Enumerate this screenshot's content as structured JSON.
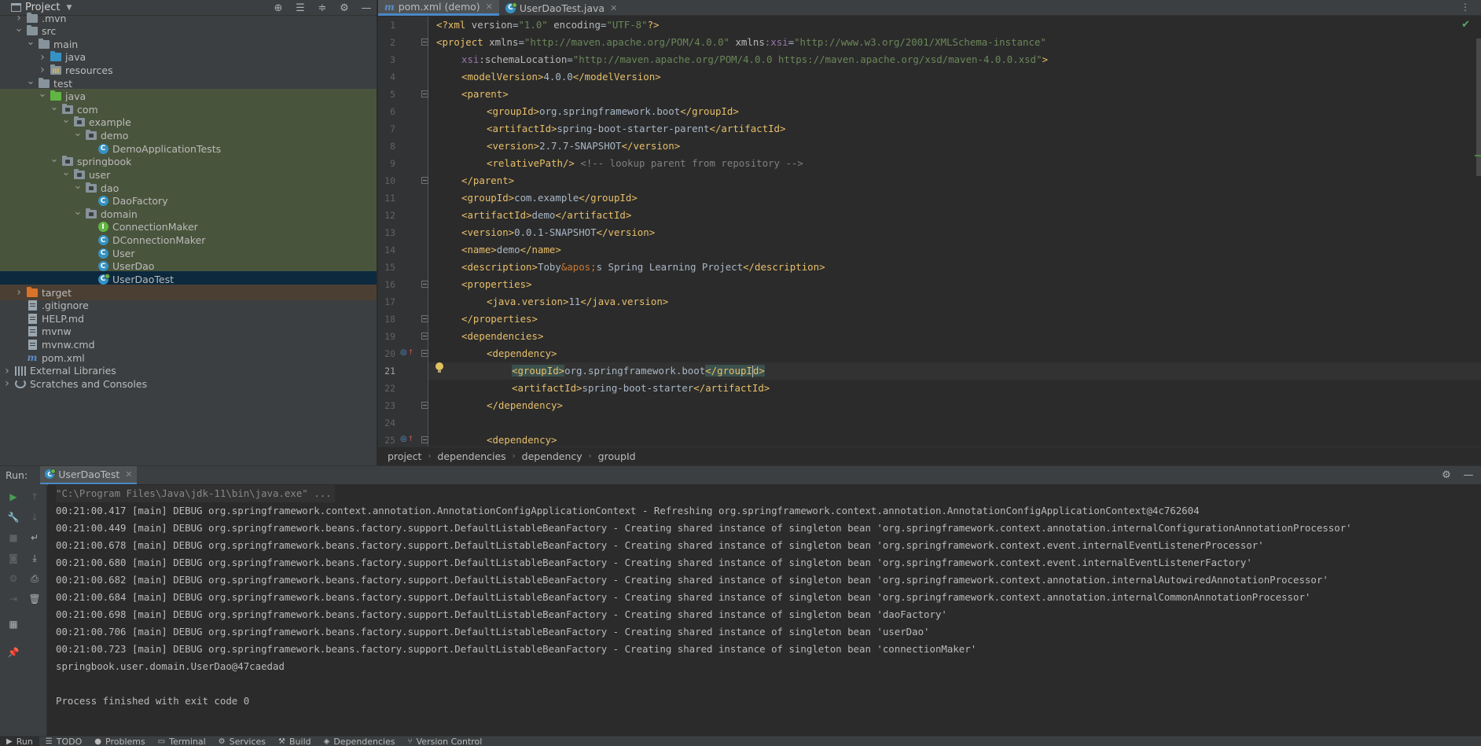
{
  "project_pane": {
    "title": "Project",
    "header_icons": [
      "locate-icon",
      "expand-all-icon",
      "collapse-all-icon",
      "gear-icon",
      "hide-icon"
    ],
    "tree": [
      {
        "label": ".mvn",
        "depth": 2,
        "expanded": false,
        "icon": "folder"
      },
      {
        "label": "src",
        "depth": 2,
        "expanded": true,
        "icon": "folder"
      },
      {
        "label": "main",
        "depth": 3,
        "expanded": true,
        "icon": "folder"
      },
      {
        "label": "java",
        "depth": 4,
        "expanded": false,
        "icon": "source-folder"
      },
      {
        "label": "resources",
        "depth": 4,
        "expanded": false,
        "icon": "resources-folder"
      },
      {
        "label": "test",
        "depth": 3,
        "expanded": true,
        "icon": "folder"
      },
      {
        "label": "java",
        "depth": 4,
        "expanded": true,
        "icon": "test-source-folder"
      },
      {
        "label": "com",
        "depth": 5,
        "expanded": true,
        "icon": "package"
      },
      {
        "label": "example",
        "depth": 6,
        "expanded": true,
        "icon": "package"
      },
      {
        "label": "demo",
        "depth": 7,
        "expanded": true,
        "icon": "package"
      },
      {
        "label": "DemoApplicationTests",
        "depth": 8,
        "icon": "class"
      },
      {
        "label": "springbook",
        "depth": 5,
        "expanded": true,
        "icon": "package"
      },
      {
        "label": "user",
        "depth": 6,
        "expanded": true,
        "icon": "package"
      },
      {
        "label": "dao",
        "depth": 7,
        "expanded": true,
        "icon": "package"
      },
      {
        "label": "DaoFactory",
        "depth": 8,
        "icon": "class"
      },
      {
        "label": "domain",
        "depth": 7,
        "expanded": true,
        "icon": "package"
      },
      {
        "label": "ConnectionMaker",
        "depth": 8,
        "icon": "interface"
      },
      {
        "label": "DConnectionMaker",
        "depth": 8,
        "icon": "class"
      },
      {
        "label": "User",
        "depth": 8,
        "icon": "class"
      },
      {
        "label": "UserDao",
        "depth": 8,
        "icon": "class"
      },
      {
        "label": "UserDaoTest",
        "depth": 8,
        "icon": "test-class"
      },
      {
        "label": "target",
        "depth": 2,
        "expanded": false,
        "icon": "excluded-folder"
      },
      {
        "label": ".gitignore",
        "depth": 2,
        "icon": "file"
      },
      {
        "label": "HELP.md",
        "depth": 2,
        "icon": "file"
      },
      {
        "label": "mvnw",
        "depth": 2,
        "icon": "file"
      },
      {
        "label": "mvnw.cmd",
        "depth": 2,
        "icon": "file"
      },
      {
        "label": "pom.xml",
        "depth": 2,
        "icon": "maven"
      },
      {
        "label": "External Libraries",
        "depth": 1,
        "expanded": false,
        "icon": "libraries"
      },
      {
        "label": "Scratches and Consoles",
        "depth": 1,
        "expanded": false,
        "icon": "scratches"
      }
    ]
  },
  "editor": {
    "tabs": [
      {
        "label": "pom.xml (demo)",
        "icon": "maven",
        "active": true
      },
      {
        "label": "UserDaoTest.java",
        "icon": "test-class",
        "active": false
      }
    ],
    "current_line": 21,
    "lines": [
      {
        "n": "1"
      },
      {
        "n": "2"
      },
      {
        "n": "3"
      },
      {
        "n": "4"
      },
      {
        "n": "5"
      },
      {
        "n": "6"
      },
      {
        "n": "7"
      },
      {
        "n": "8"
      },
      {
        "n": "9"
      },
      {
        "n": "10"
      },
      {
        "n": "11"
      },
      {
        "n": "12"
      },
      {
        "n": "13"
      },
      {
        "n": "14"
      },
      {
        "n": "15"
      },
      {
        "n": "16"
      },
      {
        "n": "17"
      },
      {
        "n": "18"
      },
      {
        "n": "19"
      },
      {
        "n": "20"
      },
      {
        "n": "21"
      },
      {
        "n": "22"
      },
      {
        "n": "23"
      },
      {
        "n": "24"
      },
      {
        "n": "25"
      }
    ],
    "code": {
      "l1_a": "<?xml ",
      "l1_b": "version",
      "l1_c": "=",
      "l1_d": "\"1.0\"",
      "l1_e": " encoding",
      "l1_f": "=",
      "l1_g": "\"UTF-8\"",
      "l1_h": "?>",
      "l2_a": "<project ",
      "l2_b": "xmlns",
      "l2_c": "=",
      "l2_d": "\"http://maven.apache.org/POM/4.0.0\"",
      "l2_e": " xmlns",
      "l2_f": ":xsi",
      "l2_g": "=",
      "l2_h": "\"http://www.w3.org/2001/XMLSchema-instance\"",
      "l3_a": "xsi",
      "l3_b": ":schemaLocation",
      "l3_c": "=",
      "l3_d": "\"http://maven.apache.org/POM/4.0.0 https://maven.apache.org/xsd/maven-4.0.0.xsd\"",
      "l3_e": ">",
      "l4_a": "<modelVersion>",
      "l4_b": "4.0.0",
      "l4_c": "</modelVersion>",
      "l5_a": "<parent>",
      "l6_a": "<groupId>",
      "l6_b": "org.springframework.boot",
      "l6_c": "</groupId>",
      "l7_a": "<artifactId>",
      "l7_b": "spring-boot-starter-parent",
      "l7_c": "</artifactId>",
      "l8_a": "<version>",
      "l8_b": "2.7.7-SNAPSHOT",
      "l8_c": "</version>",
      "l9_a": "<relativePath/>",
      "l9_b": " <!-- lookup parent from repository -->",
      "l10_a": "</parent>",
      "l11_a": "<groupId>",
      "l11_b": "com.example",
      "l11_c": "</groupId>",
      "l12_a": "<artifactId>",
      "l12_b": "demo",
      "l12_c": "</artifactId>",
      "l13_a": "<version>",
      "l13_b": "0.0.1-SNAPSHOT",
      "l13_c": "</version>",
      "l14_a": "<name>",
      "l14_b": "demo",
      "l14_c": "</name>",
      "l15_a": "<description>",
      "l15_b": "Toby",
      "l15_c": "&apos;",
      "l15_d": "s Spring Learning Project",
      "l15_e": "</description>",
      "l16_a": "<properties>",
      "l17_a": "<java.version>",
      "l17_b": "11",
      "l17_c": "</java.version>",
      "l18_a": "</properties>",
      "l19_a": "<dependencies>",
      "l20_a": "<dependency>",
      "l21_a": "<groupId>",
      "l21_b": "org.springframework.boot",
      "l21_c": "</groupI",
      "l21_d": "d>",
      "l22_a": "<artifactId>",
      "l22_b": "spring-boot-starter",
      "l22_c": "</artifactId>",
      "l23_a": "</dependency>",
      "l25_a": "<dependency>"
    },
    "breadcrumb": [
      "project",
      "dependencies",
      "dependency",
      "groupId"
    ]
  },
  "run": {
    "label": "Run:",
    "tab": "UserDaoTest",
    "console": [
      "\"C:\\Program Files\\Java\\jdk-11\\bin\\java.exe\" ...",
      "00:21:00.417 [main] DEBUG org.springframework.context.annotation.AnnotationConfigApplicationContext - Refreshing org.springframework.context.annotation.AnnotationConfigApplicationContext@4c762604",
      "00:21:00.449 [main] DEBUG org.springframework.beans.factory.support.DefaultListableBeanFactory - Creating shared instance of singleton bean 'org.springframework.context.annotation.internalConfigurationAnnotationProcessor'",
      "00:21:00.678 [main] DEBUG org.springframework.beans.factory.support.DefaultListableBeanFactory - Creating shared instance of singleton bean 'org.springframework.context.event.internalEventListenerProcessor'",
      "00:21:00.680 [main] DEBUG org.springframework.beans.factory.support.DefaultListableBeanFactory - Creating shared instance of singleton bean 'org.springframework.context.event.internalEventListenerFactory'",
      "00:21:00.682 [main] DEBUG org.springframework.beans.factory.support.DefaultListableBeanFactory - Creating shared instance of singleton bean 'org.springframework.context.annotation.internalAutowiredAnnotationProcessor'",
      "00:21:00.684 [main] DEBUG org.springframework.beans.factory.support.DefaultListableBeanFactory - Creating shared instance of singleton bean 'org.springframework.context.annotation.internalCommonAnnotationProcessor'",
      "00:21:00.698 [main] DEBUG org.springframework.beans.factory.support.DefaultListableBeanFactory - Creating shared instance of singleton bean 'daoFactory'",
      "00:21:00.706 [main] DEBUG org.springframework.beans.factory.support.DefaultListableBeanFactory - Creating shared instance of singleton bean 'userDao'",
      "00:21:00.723 [main] DEBUG org.springframework.beans.factory.support.DefaultListableBeanFactory - Creating shared instance of singleton bean 'connectionMaker'",
      "springbook.user.domain.UserDao@47caedad",
      "",
      "Process finished with exit code 0"
    ]
  },
  "bottom_bar": [
    {
      "label": "Run",
      "icon": "play-icon",
      "active": true
    },
    {
      "label": "TODO",
      "icon": "todo-icon"
    },
    {
      "label": "Problems",
      "icon": "problems-icon"
    },
    {
      "label": "Terminal",
      "icon": "terminal-icon"
    },
    {
      "label": "Services",
      "icon": "services-icon"
    },
    {
      "label": "Build",
      "icon": "build-icon"
    },
    {
      "label": "Dependencies",
      "icon": "dependencies-icon"
    },
    {
      "label": "Version Control",
      "icon": "version-control-icon"
    }
  ]
}
